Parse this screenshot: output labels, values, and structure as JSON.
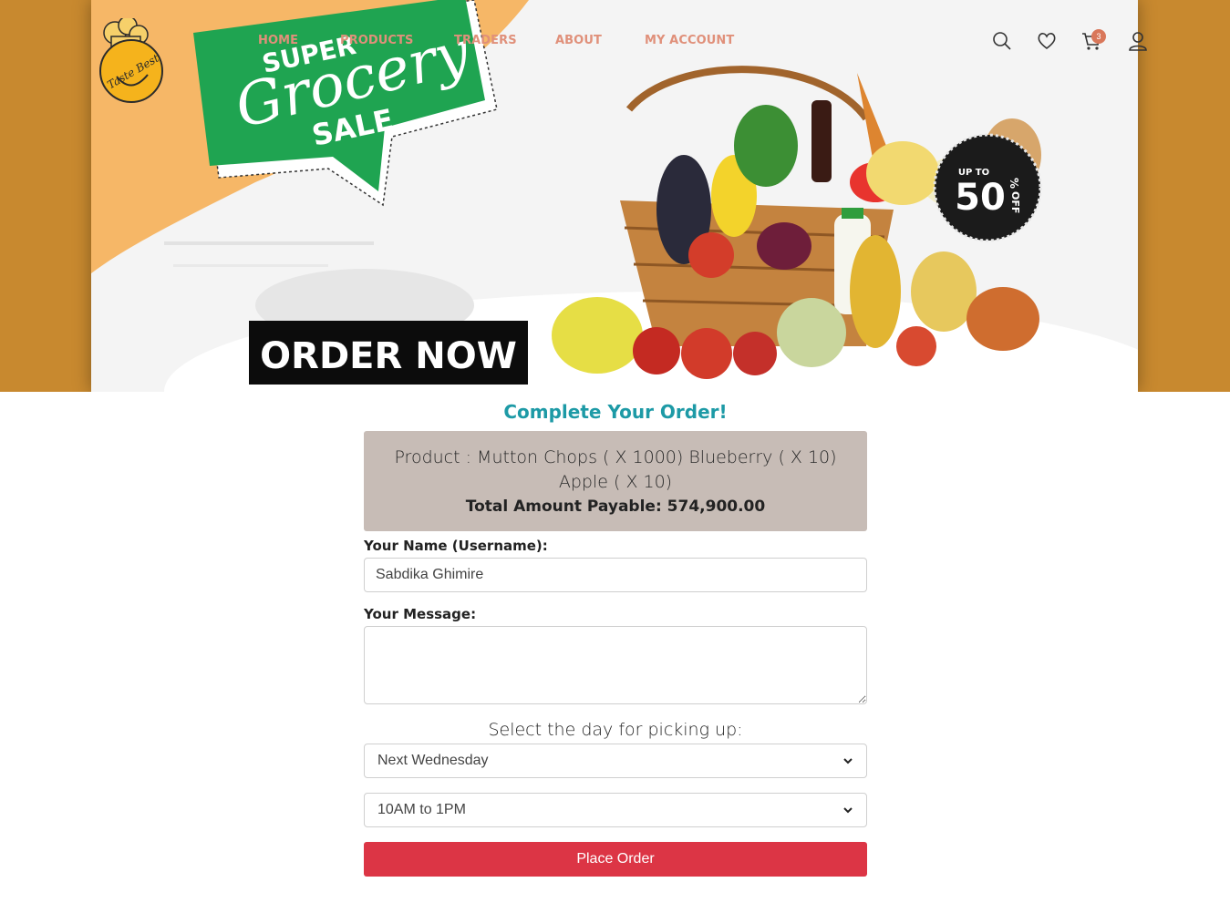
{
  "nav": {
    "items": [
      "HOME",
      "PRODUCTS",
      "TRADERS",
      "ABOUT",
      "MY ACCOUNT"
    ]
  },
  "header_icons": [
    "search-icon",
    "heart-icon",
    "cart-icon",
    "user-icon"
  ],
  "cart_count": "3",
  "logo": {
    "text": "Taste Best"
  },
  "banner": {
    "line1": "SUPER",
    "line2": "Grocery",
    "line3": "SALE",
    "cta": "ORDER NOW",
    "badge_top": "UP TO",
    "badge_num": "50",
    "badge_pct": "%",
    "badge_off": "OFF"
  },
  "form": {
    "title": "Complete Your Order!",
    "product_line": "Product : Mutton Chops ( X 1000) Blueberry ( X 10) Apple ( X 10)",
    "total_label": "Total Amount Payable: 574,900.00",
    "name_label": "Your Name (Username):",
    "name_value": "Sabdika Ghimire",
    "message_label": "Your Message:",
    "message_value": "",
    "day_label": "Select the day for picking up:",
    "day_value": "Next Wednesday",
    "time_value": "10AM to 1PM",
    "submit_label": "Place Order"
  },
  "colors": {
    "accent_title": "#1d9aa6",
    "nav_link": "#e0907a",
    "submit": "#dc3545",
    "summary_bg": "#c7bcb6",
    "page_border": "#c8892f",
    "banner_green": "#1fa451"
  }
}
